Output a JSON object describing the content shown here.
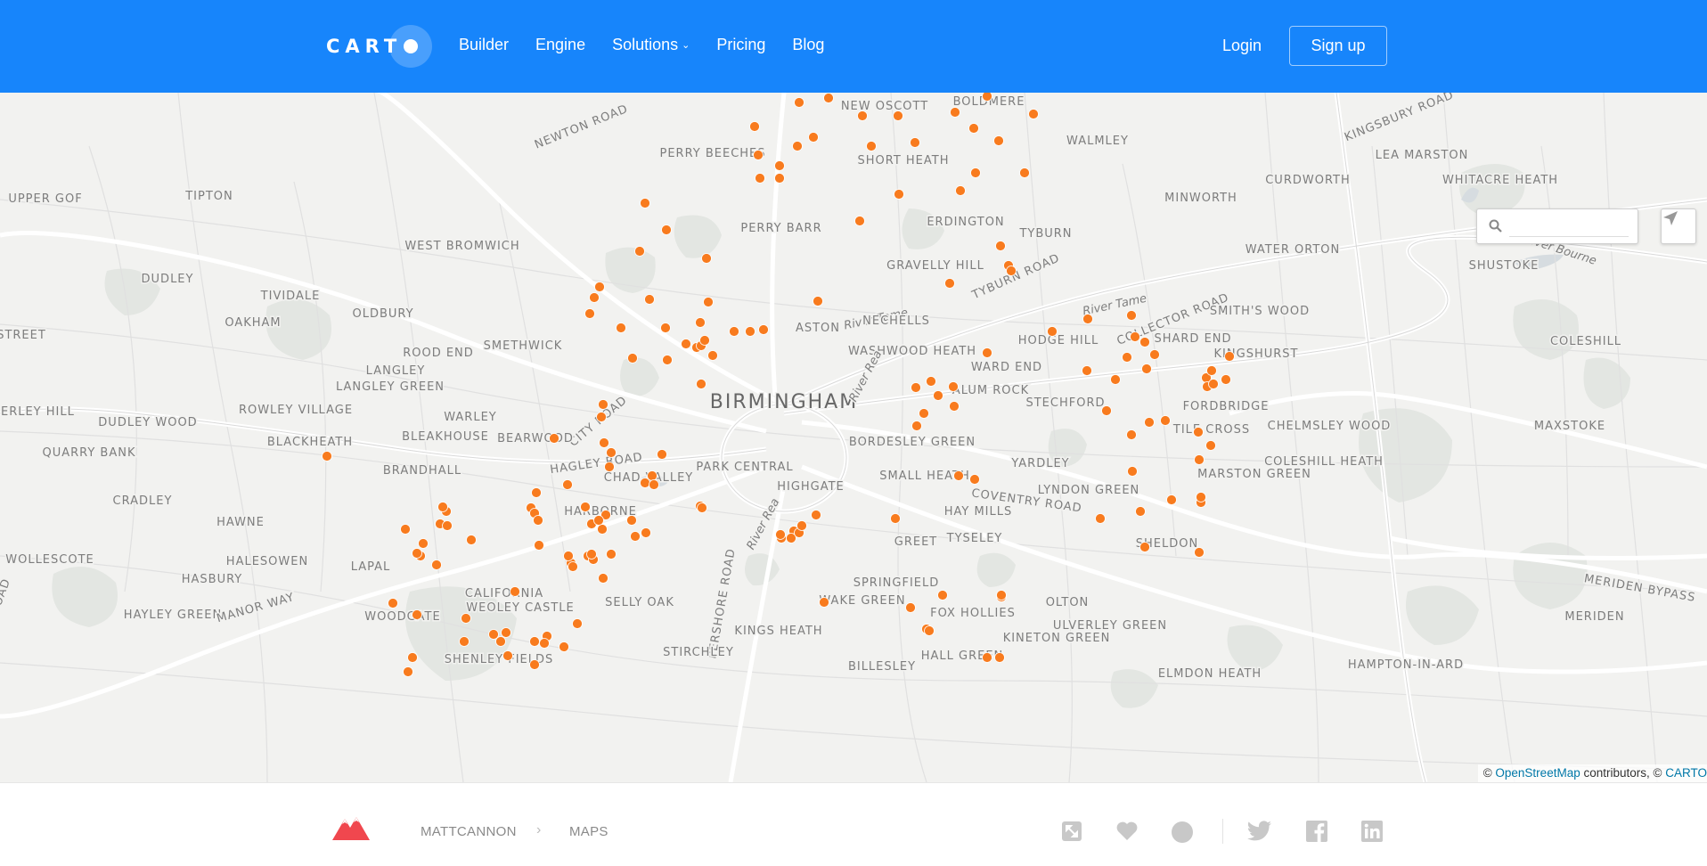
{
  "header": {
    "logo_text": "CART",
    "nav": [
      {
        "label": "Builder"
      },
      {
        "label": "Engine"
      },
      {
        "label": "Solutions",
        "dropdown": true
      },
      {
        "label": "Pricing"
      },
      {
        "label": "Blog"
      }
    ],
    "login_label": "Login",
    "signup_label": "Sign up",
    "color": "#1785fb"
  },
  "map": {
    "marker_color": "#f87b1e",
    "labels": {
      "birmingham": "BIRMINGHAM",
      "newton_road": "NEWTON ROAD",
      "new_oscott": "NEW OSCOTT",
      "boldmere": "BOLDMERE",
      "perry_beeches": "PERRY BEECHES",
      "short_heath": "SHORT HEATH",
      "walmley": "WALMLEY",
      "kingsbury_road": "KINGSBURY ROAD",
      "lea_marston": "LEA MARSTON",
      "upper_gof": "UPPER GOF",
      "tipton": "TIPTON",
      "curdworth": "CURDWORTH",
      "whitacre_heath": "WHITACRE HEATH",
      "minworth": "MINWORTH",
      "perry_barr": "PERRY BARR",
      "erdington": "ERDINGTON",
      "west_bromwich": "WEST BROMWICH",
      "tyburn": "TYBURN",
      "water_orton": "WATER ORTON",
      "river_bourne": "River Bourne",
      "dudley": "DUDLEY",
      "gravelly_hill": "GRAVELLY HILL",
      "tyburn_road": "TYBURN ROAD",
      "shustoke": "SHUSTOKE",
      "tividale": "TIVIDALE",
      "river_tame_1": "River Tame",
      "river_tame_2": "River Tame",
      "collector_road": "COLLECTOR ROAD",
      "oldbury": "OLDBURY",
      "oakham": "OAKHAM",
      "smiths_wood": "SMITH'S WOOD",
      "aston": "ASTON",
      "nechells": "NECHELLS",
      "street": "STREET",
      "hodge_hill": "HODGE HILL",
      "shard_end": "SHARD END",
      "coleshill": "COLESHILL",
      "smethwick": "SMETHWICK",
      "washwood_heath": "WASHWOOD HEATH",
      "rood_end": "ROOD END",
      "kingshurst": "KINGSHURST",
      "langley": "LANGLEY",
      "ward_end": "WARD END",
      "langley_green": "LANGLEY GREEN",
      "alum_rock": "ALUM ROCK",
      "river_rea_1": "River Rea",
      "stechford": "STECHFORD",
      "fordbridge": "FORDBRIDGE",
      "rowley_village": "ROWLEY VILLAGE",
      "blakley_hill": "IERLEY HILL",
      "city_road": "CITY ROAD",
      "warley": "WARLEY",
      "dudley_wood": "DUDLEY WOOD",
      "chelmsley_wood": "CHELMSLEY WOOD",
      "maxstoke": "MAXSTOKE",
      "tile_cross": "TILE CROSS",
      "blackheath": "BLACKHEATH",
      "bleakhouse": "BLEAKHOUSE",
      "bearwood": "BEARWOOD",
      "bordesley_green": "BORDESLEY GREEN",
      "quarry_bank": "QUARRY BANK",
      "coleshill_heath": "COLESHILL HEATH",
      "hagley_road": "HAGLEY ROAD",
      "park_central": "PARK CENTRAL",
      "yardley": "YARDLEY",
      "brandhall": "BRANDHALL",
      "marston_green": "MARSTON GREEN",
      "chad_valley": "CHAD VALLEY",
      "small_heath": "SMALL HEATH",
      "highgate": "HIGHGATE",
      "lyndon_green": "LYNDON GREEN",
      "coventry_road": "COVENTRY ROAD",
      "cradley": "CRADLEY",
      "harborne": "HARBORNE",
      "river_rea_2": "River Rea",
      "hay_mills": "HAY MILLS",
      "hawne": "HAWNE",
      "greet": "GREET",
      "tyseley": "TYSELEY",
      "sheldon": "SHELDON",
      "wollescote": "WOLLESCOTE",
      "halesowen": "HALESOWEN",
      "lapal": "LAPAL",
      "hasbury": "HASBURY",
      "pershore_road": "PERSHORE ROAD",
      "springfield": "SPRINGFIELD",
      "meriden_bypass": "MERIDEN BYPASS",
      "california": "CALIFORNIA",
      "wake_green": "WAKE GREEN",
      "olton": "OLTON",
      "selly_oak": "SELLY OAK",
      "weoley_castle": "WEOLEY CASTLE",
      "hayley_green": "HAYLEY GREEN",
      "manor_way": "MANOR WAY",
      "fox_hollies": "FOX HOLLIES",
      "ulverley_green": "ULVERLEY GREEN",
      "meriden": "MERIDEN",
      "woodgate": "WOODGATE",
      "kings_heath": "KINGS HEATH",
      "kineton_green": "KINETON GREEN",
      "stirchley": "STIRCHLEY",
      "hall_green": "HALL GREEN",
      "shenley_fields": "SHENLEY FIELDS",
      "billesley": "BILLESLEY",
      "elmdon_heath": "ELMDON HEATH",
      "hampton_in_arden": "HAMPTON-IN-ARD",
      "oad": "OAD",
      "woodgate_valley": "WOODGATE"
    },
    "search_placeholder": "",
    "attribution": {
      "prefix": "©",
      "osm": "OpenStreetMap",
      "middle": "contributors, ©",
      "carto": "CARTO"
    }
  },
  "footer": {
    "user": "MATTCANNON",
    "separator": "›",
    "section": "MAPS",
    "icons": [
      "fullscreen-icon",
      "heart-icon",
      "circle-icon",
      "twitter-icon",
      "facebook-icon",
      "linkedin-icon"
    ],
    "accent": "#f0474e"
  }
}
